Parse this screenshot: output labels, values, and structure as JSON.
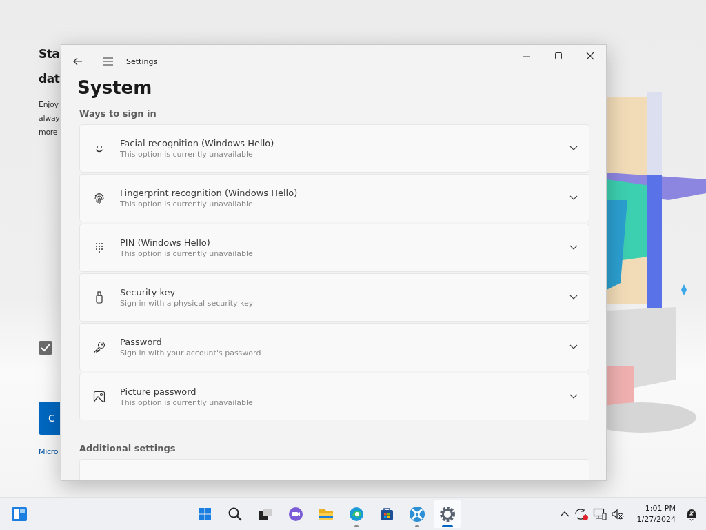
{
  "background_app": {
    "heading_lines": [
      "Sta",
      "dat"
    ],
    "body_lines": [
      "Enjoy",
      "alway",
      "more"
    ],
    "checkbox": {
      "checked": true
    },
    "button": "C",
    "link": "Micro"
  },
  "window": {
    "title": "Settings",
    "page_title": "System",
    "section": "Ways to sign in",
    "options": [
      {
        "kind": "face",
        "title": "Facial recognition (Windows Hello)",
        "subtitle": "This option is currently unavailable",
        "expanded": false
      },
      {
        "kind": "fingerprint",
        "title": "Fingerprint recognition (Windows Hello)",
        "subtitle": "This option is currently unavailable",
        "expanded": false
      },
      {
        "kind": "pin",
        "title": "PIN (Windows Hello)",
        "subtitle": "This option is currently unavailable",
        "expanded": false
      },
      {
        "kind": "security_key",
        "title": "Security key",
        "subtitle": "Sign in with a physical security key",
        "expanded": false
      },
      {
        "kind": "password",
        "title": "Password",
        "subtitle": "Sign in with your account's password",
        "expanded": false
      },
      {
        "kind": "picture_password",
        "title": "Picture password",
        "subtitle": "This option is currently unavailable",
        "expanded": false
      }
    ],
    "section_2": "Additional settings"
  },
  "taskbar": {
    "apps": [
      {
        "kind": "start",
        "running": false,
        "selected": false
      },
      {
        "kind": "search",
        "running": false,
        "selected": false
      },
      {
        "kind": "task_view",
        "running": false,
        "selected": false
      },
      {
        "kind": "chat",
        "running": false,
        "selected": false
      },
      {
        "kind": "explorer",
        "running": false,
        "selected": false
      },
      {
        "kind": "edge",
        "running": true,
        "selected": false
      },
      {
        "kind": "store",
        "running": false,
        "selected": false
      },
      {
        "kind": "app",
        "running": true,
        "selected": false
      },
      {
        "kind": "settings",
        "running": true,
        "selected": true
      }
    ],
    "time": "1:01 PM",
    "date": "1/27/2024"
  }
}
